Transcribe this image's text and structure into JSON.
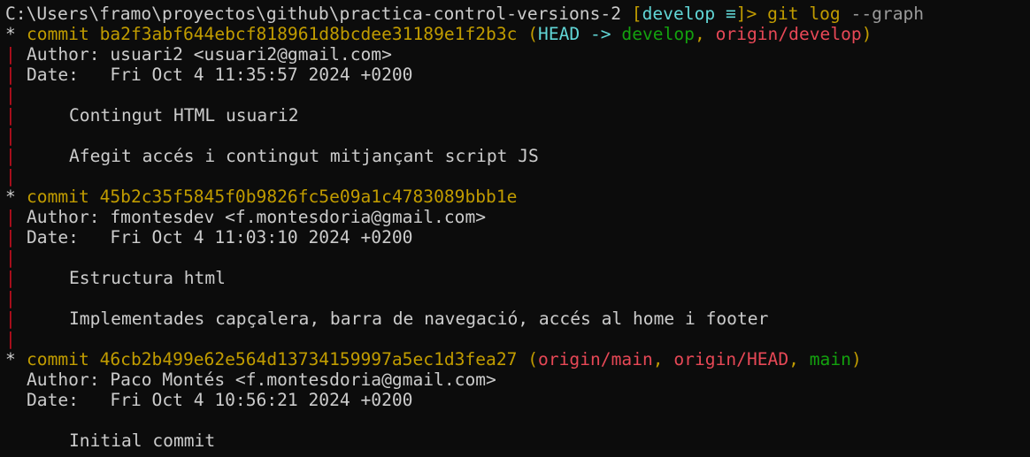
{
  "prompt": {
    "path": "C:\\Users\\framo\\proyectos\\github\\practica-control-versions-2",
    "bracket_open": " [",
    "branch": "develop",
    "branch_symbol": " ≡",
    "bracket_close": "]> ",
    "cmd": "git log",
    "arg": " --graph"
  },
  "graph": {
    "star": "*",
    "pipe": "|"
  },
  "commits": [
    {
      "keyword": "commit ",
      "hash": "ba2f3abf644ebcf818961d8bcdee31189e1f2b3c",
      "refs_open": " (",
      "head": "HEAD -> ",
      "ref1": "develop",
      "sep1": ", ",
      "ref2": "origin/develop",
      "refs_close": ")",
      "author_line": "Author: usuari2 <usuari2@gmail.com>",
      "date_line": "Date:   Fri Oct 4 11:35:57 2024 +0200",
      "subject": "Contingut HTML usuari2",
      "body": "Afegit accés i contingut mitjançant script JS"
    },
    {
      "keyword": "commit ",
      "hash": "45b2c35f5845f0b9826fc5e09a1c4783089bbb1e",
      "author_line": "Author: fmontesdev <f.montesdoria@gmail.com>",
      "date_line": "Date:   Fri Oct 4 11:03:10 2024 +0200",
      "subject": "Estructura html",
      "body": "Implementades capçalera, barra de navegació, accés al home i footer"
    },
    {
      "keyword": "commit ",
      "hash": "46cb2b499e62e564d13734159997a5ec1d3fea27",
      "refs_open": " (",
      "ref1": "origin/main",
      "sep1": ", ",
      "ref2": "origin/HEAD",
      "sep2": ", ",
      "ref3": "main",
      "refs_close": ")",
      "author_line": "Author: Paco Montés <f.montesdoria@gmail.com>",
      "date_line": "Date:   Fri Oct 4 10:56:21 2024 +0200",
      "subject": "Initial commit"
    }
  ]
}
